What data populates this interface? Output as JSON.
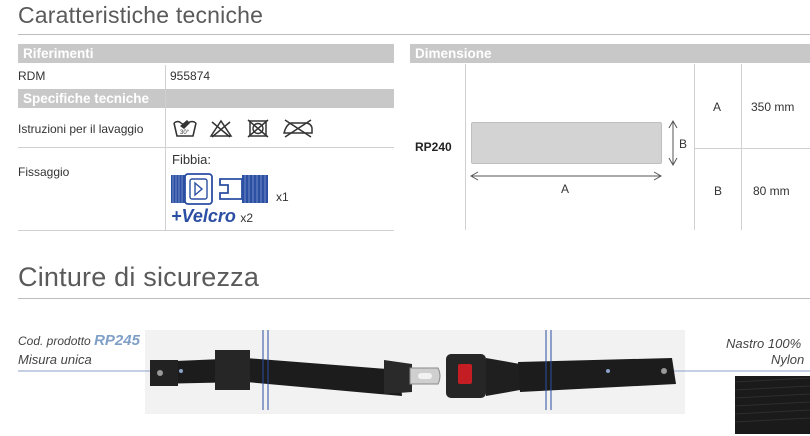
{
  "section_specs": {
    "title": "Caratteristiche tecniche",
    "riferimenti": {
      "header": "Riferimenti",
      "rdm_label": "RDM",
      "rdm_value": "955874"
    },
    "specifiche": {
      "header": "Specifiche tecniche",
      "wash_label": "Istruzioni per  il lavaggio",
      "wash_icons": [
        "wash-30-icon",
        "no-bleach-icon",
        "no-tumble-dry-icon",
        "no-iron-icon"
      ],
      "fix_label": "Fissaggio",
      "fibbia_label": "Fibbia:",
      "fibbia_qty": "x1",
      "velcro_label": "+Velcro",
      "velcro_qty": "x2"
    },
    "dimensione": {
      "header": "Dimensione",
      "model": "RP240",
      "label_a": "A",
      "label_b": "B",
      "rows": [
        {
          "key": "A",
          "value": "350 mm"
        },
        {
          "key": "B",
          "value": "80 mm"
        }
      ]
    }
  },
  "section_belts": {
    "title": "Cinture di sicurezza",
    "code_prefix": "Cod. prodotto",
    "code": "RP245",
    "size": "Misura unica",
    "material_line1": "Nastro 100%",
    "material_line2": "Nylon"
  },
  "colors": {
    "band_gray": "#c8c8c8",
    "accent_blue": "#2b4fa3",
    "code_blue": "#7f9fc7",
    "belt_black": "#1c1c1c",
    "buckle_red": "#c41e24"
  }
}
